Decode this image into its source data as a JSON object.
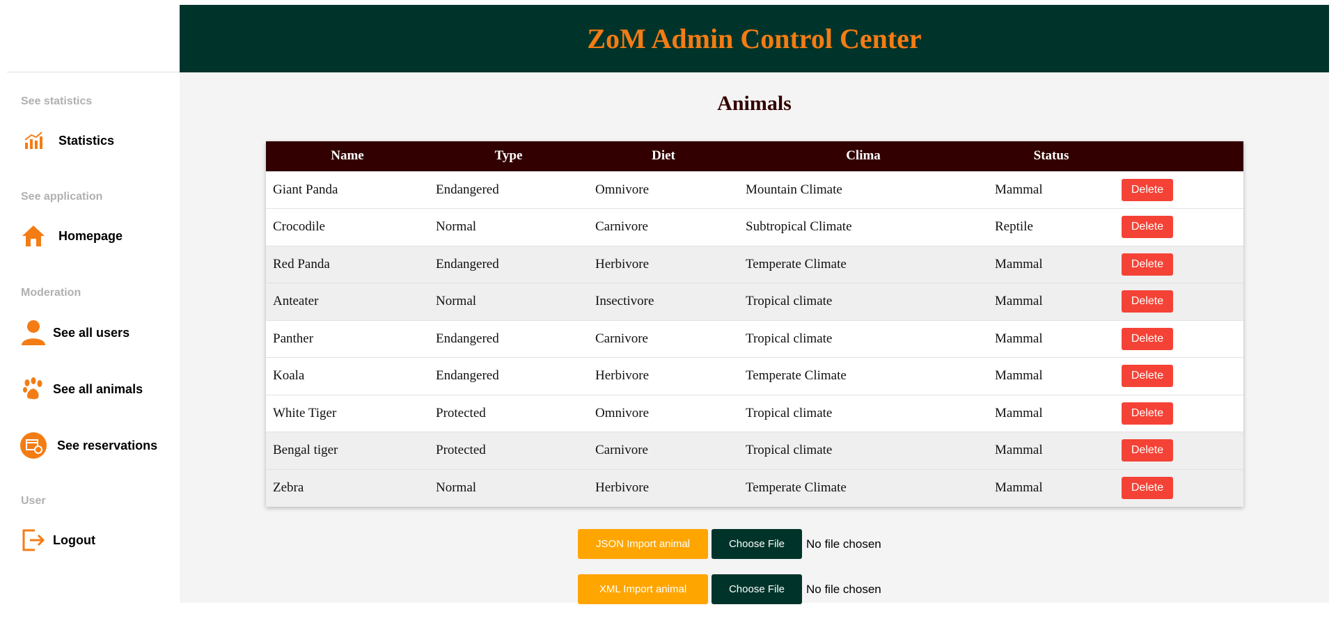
{
  "header": {
    "title": "ZoM Admin Control Center"
  },
  "sidebar": {
    "sections": [
      {
        "label": "See statistics",
        "items": [
          {
            "label": "Statistics",
            "icon": "bar-chart-icon"
          }
        ]
      },
      {
        "label": "See application",
        "items": [
          {
            "label": "Homepage",
            "icon": "home-icon"
          }
        ]
      },
      {
        "label": "Moderation",
        "items": [
          {
            "label": "See all users",
            "icon": "user-icon"
          },
          {
            "label": "See all animals",
            "icon": "paw-icon"
          },
          {
            "label": "See reservations",
            "icon": "calendar-clock-icon"
          }
        ]
      },
      {
        "label": "User",
        "items": [
          {
            "label": "Logout",
            "icon": "logout-icon"
          }
        ]
      }
    ]
  },
  "main": {
    "title": "Animals",
    "table": {
      "columns": [
        "Name",
        "Type",
        "Diet",
        "Clima",
        "Status",
        ""
      ],
      "rows": [
        [
          "Giant Panda",
          "Endangered",
          "Omnivore",
          "Mountain Climate",
          "Mammal"
        ],
        [
          "Crocodile",
          "Normal",
          "Carnivore",
          "Subtropical Climate",
          "Reptile"
        ],
        [
          "Red Panda",
          "Endangered",
          "Herbivore",
          "Temperate Climate",
          "Mammal"
        ],
        [
          "Anteater",
          "Normal",
          "Insectivore",
          "Tropical climate",
          "Mammal"
        ],
        [
          "Panther",
          "Endangered",
          "Carnivore",
          "Tropical climate",
          "Mammal"
        ],
        [
          "Koala",
          "Endangered",
          "Herbivore",
          "Temperate Climate",
          "Mammal"
        ],
        [
          "White Tiger",
          "Protected",
          "Omnivore",
          "Tropical climate",
          "Mammal"
        ],
        [
          "Bengal tiger",
          "Protected",
          "Carnivore",
          "Tropical climate",
          "Mammal"
        ],
        [
          "Zebra",
          "Normal",
          "Herbivore",
          "Temperate Climate",
          "Mammal"
        ]
      ],
      "delete_label": "Delete"
    },
    "imports": [
      {
        "button": "JSON Import animal",
        "choose": "Choose File",
        "status": "No file chosen"
      },
      {
        "button": "XML Import animal",
        "choose": "Choose File",
        "status": "No file chosen"
      }
    ]
  },
  "colors": {
    "header_bg": "#00342a",
    "title_orange": "#f47c14",
    "table_header_bg": "#320000",
    "delete_red": "#f44336",
    "import_orange": "#ffa500",
    "icon_orange": "#f47c14"
  }
}
